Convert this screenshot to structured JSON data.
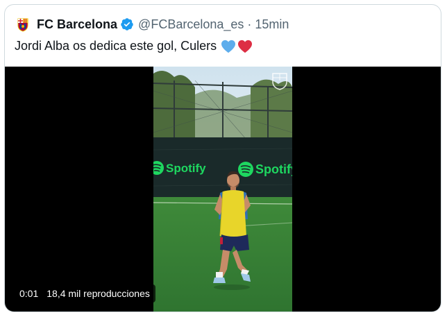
{
  "tweet": {
    "author_name": "FC Barcelona",
    "handle": "@FCBarcelona_es",
    "separator": "·",
    "time": "15min",
    "text": "Jordi Alba os dedica este gol, Culers",
    "emojis": [
      "blue-heart",
      "red-heart"
    ],
    "verified": true
  },
  "video": {
    "elapsed": "0:01",
    "views": "18,4 mil reproducciones",
    "banner_text": "Spotify"
  },
  "colors": {
    "verified_blue": "#1d9bf0",
    "secondary_text": "#536471",
    "spotify_green": "#1ed760"
  }
}
